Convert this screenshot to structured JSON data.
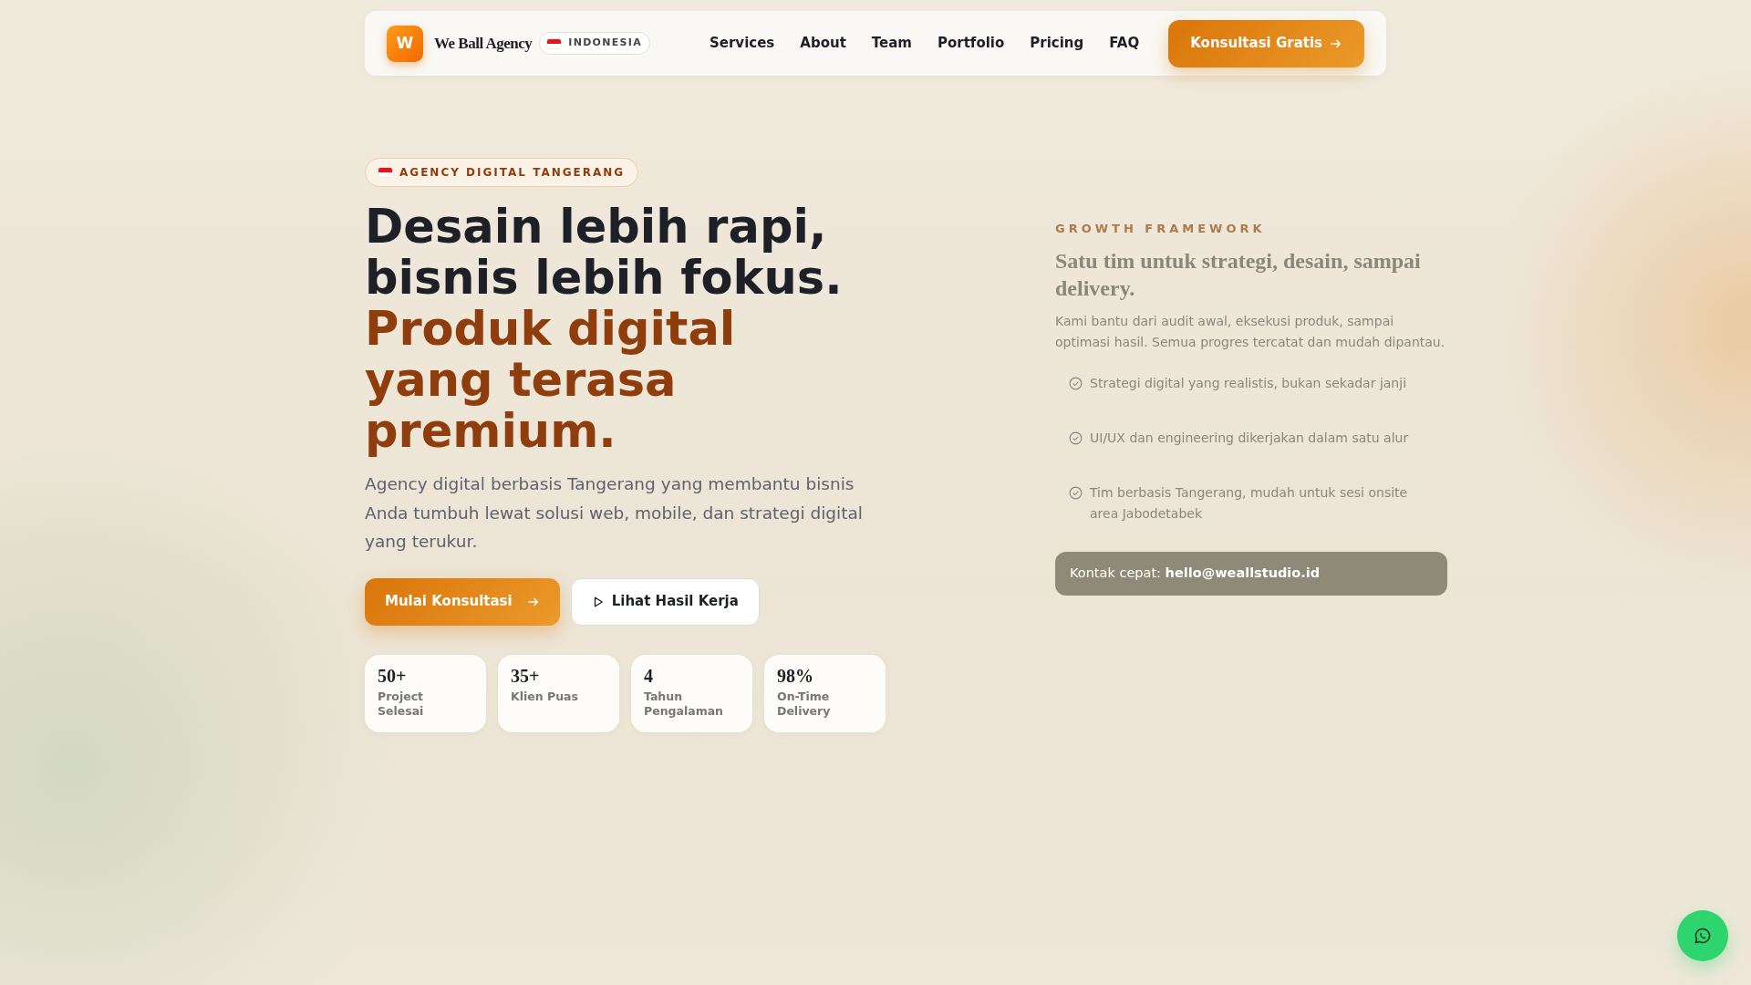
{
  "navbar": {
    "logo_letter": "W",
    "brand": "We Ball Agency",
    "country": "INDONESIA",
    "links": [
      "Services",
      "About",
      "Team",
      "Portfolio",
      "Pricing",
      "FAQ"
    ],
    "cta": "Konsultasi Gratis"
  },
  "hero": {
    "badge": "AGENCY DIGITAL TANGERANG",
    "title_lines": [
      {
        "text": "Desain lebih rapi,",
        "kind": "plain"
      },
      {
        "text": "bisnis lebih fokus.",
        "kind": "plain"
      },
      {
        "text": "Produk digital yang terasa premium.",
        "kind": "accent"
      }
    ],
    "lead": "Agency digital berbasis Tangerang yang membantu bisnis Anda tumbuh lewat solusi web, mobile, dan strategi digital yang terukur.",
    "buttons": [
      {
        "label": "Mulai Konsultasi",
        "kind": "primary"
      },
      {
        "label": "Lihat Hasil Kerja",
        "kind": "outline"
      }
    ],
    "stats": [
      {
        "value": "50+",
        "label": "Project Selesai"
      },
      {
        "value": "35+",
        "label": "Klien Puas"
      },
      {
        "value": "4",
        "label": "Tahun Pengalaman"
      },
      {
        "value": "98%",
        "label": "On-Time Delivery"
      }
    ]
  },
  "framework": {
    "eyebrow": "GROWTH FRAMEWORK",
    "title": "Satu tim untuk strategi, desain, sampai delivery.",
    "text": "Kami bantu dari audit awal, eksekusi produk, sampai optimasi hasil. Semua progres tercatat dan mudah dipantau.",
    "points": [
      "Strategi digital yang realistis, bukan sekadar janji",
      "UI/UX dan engineering dikerjakan dalam satu alur",
      "Tim berbasis Tangerang, mudah untuk sesi onsite area Jabodetabek"
    ],
    "contact_label": "Kontak cepat:",
    "contact_email": "hello@weallstudio.id"
  }
}
